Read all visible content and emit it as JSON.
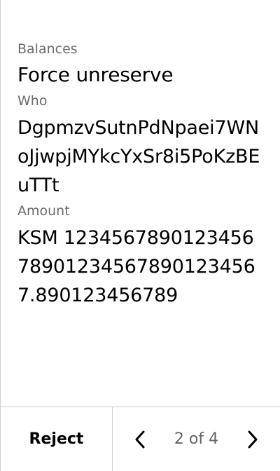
{
  "transaction": {
    "module": "Balances",
    "method": "Force unreserve",
    "fields": [
      {
        "label": "Who",
        "value": "DgpmzvSutnPdNpaei7WNoJjwpjMYkcYxSr8i5PoKzBEuTTt"
      },
      {
        "label": "Amount",
        "value": "KSM 1234567890123456789012345678901234567.890123456789"
      }
    ]
  },
  "footer": {
    "reject_label": "Reject",
    "page_indicator": "2 of 4"
  },
  "icons": {
    "prev": "chevron-left-icon",
    "next": "chevron-right-icon"
  },
  "colors": {
    "label": "#6b6b6b",
    "divider": "#cfcfcf",
    "page_indicator": "#666666"
  }
}
